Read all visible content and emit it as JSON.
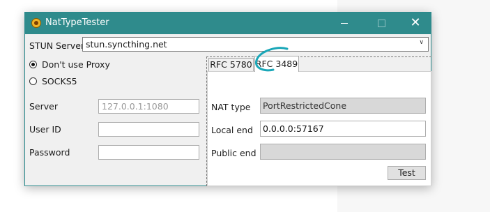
{
  "window": {
    "title": "NatTypeTester"
  },
  "stun": {
    "label": "STUN Server",
    "value": "stun.syncthing.net"
  },
  "proxy": {
    "options": [
      {
        "label": "Don't use Proxy",
        "selected": true
      },
      {
        "label": "SOCKS5",
        "selected": false
      }
    ],
    "server": {
      "label": "Server",
      "value": "127.0.0.1:1080"
    },
    "user_id": {
      "label": "User ID",
      "value": ""
    },
    "password": {
      "label": "Password",
      "value": ""
    }
  },
  "tabs": [
    {
      "label": "RFC 5780",
      "active": false
    },
    {
      "label": "RFC 3489",
      "active": true
    }
  ],
  "rfc3489": {
    "nat_type": {
      "label": "NAT type",
      "value": "PortRestrictedCone"
    },
    "local_end": {
      "label": "Local end",
      "value": "0.0.0.0:57167"
    },
    "public_end": {
      "label": "Public end",
      "value": ""
    },
    "test_label": "Test"
  },
  "colors": {
    "titlebar": "#2f8b8c",
    "annotation": "#1aa7b8"
  }
}
